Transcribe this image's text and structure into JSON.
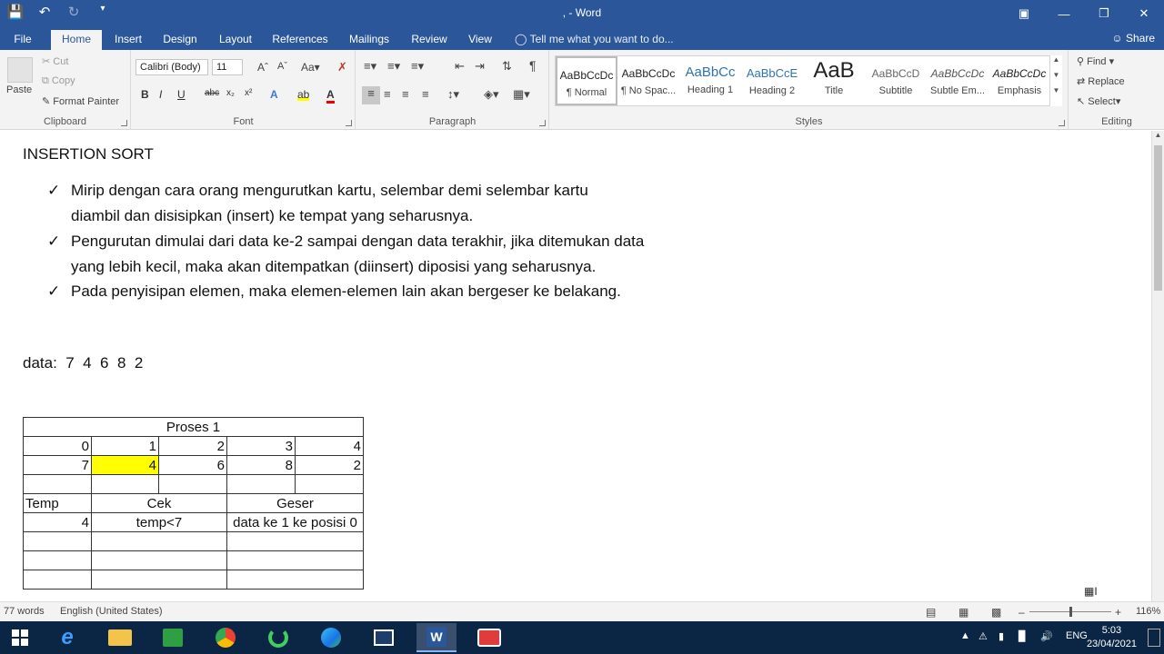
{
  "window": {
    "title": ", - Word",
    "qat": [
      "save",
      "undo",
      "redo",
      "customize"
    ]
  },
  "tabs": [
    "File",
    "Home",
    "Insert",
    "Design",
    "Layout",
    "References",
    "Mailings",
    "Review",
    "View"
  ],
  "active_tab": "Home",
  "tell_me": "Tell me what you want to do...",
  "share": "Share",
  "ribbon": {
    "clipboard": {
      "paste": "Paste",
      "cut": "Cut",
      "copy": "Copy",
      "format_painter": "Format Painter",
      "label": "Clipboard"
    },
    "font": {
      "name": "Calibri (Body)",
      "size": "11",
      "label": "Font"
    },
    "paragraph": {
      "label": "Paragraph"
    },
    "styles": {
      "label": "Styles",
      "items": [
        {
          "sample": "AaBbCcDc",
          "name": "¶ Normal"
        },
        {
          "sample": "AaBbCcDc",
          "name": "¶ No Spac..."
        },
        {
          "sample": "AaBbCc",
          "name": "Heading 1"
        },
        {
          "sample": "AaBbCcE",
          "name": "Heading 2"
        },
        {
          "sample": "AaB",
          "name": "Title"
        },
        {
          "sample": "AaBbCcD",
          "name": "Subtitle"
        },
        {
          "sample": "AaBbCcDc",
          "name": "Subtle Em..."
        },
        {
          "sample": "AaBbCcDc",
          "name": "Emphasis"
        }
      ]
    },
    "editing": {
      "find": "Find",
      "replace": "Replace",
      "select": "Select",
      "label": "Editing"
    }
  },
  "document": {
    "heading": "INSERTION SORT",
    "bullets": [
      [
        "Mirip dengan cara orang mengurutkan kartu, selembar demi selembar kartu",
        "diambil dan disisipkan (insert) ke tempat yang seharusnya."
      ],
      [
        "Pengurutan dimulai dari data ke-2 sampai dengan data terakhir, jika ditemukan data",
        "yang lebih kecil, maka akan ditempatkan (diinsert) diposisi yang seharusnya."
      ],
      [
        "Pada penyisipan elemen, maka elemen-elemen lain akan bergeser ke belakang."
      ]
    ],
    "data_line": "data:  7  4  6  8  2",
    "table": {
      "title": "Proses 1",
      "indices": [
        "0",
        "1",
        "2",
        "3",
        "4"
      ],
      "values": [
        "7",
        "4",
        "6",
        "8",
        "2"
      ],
      "highlight_index": 1,
      "headers": {
        "temp": "Temp",
        "cek": "Cek",
        "geser": "Geser"
      },
      "row1": {
        "temp": "4",
        "cek": "temp<7",
        "geser": "data ke 1 ke posisi 0"
      }
    }
  },
  "status": {
    "words": "77 words",
    "language": "English (United States)",
    "zoom": "116%"
  },
  "taskbar": {
    "lang": "ENG",
    "time": "5:03",
    "date": "23/04/2021"
  }
}
